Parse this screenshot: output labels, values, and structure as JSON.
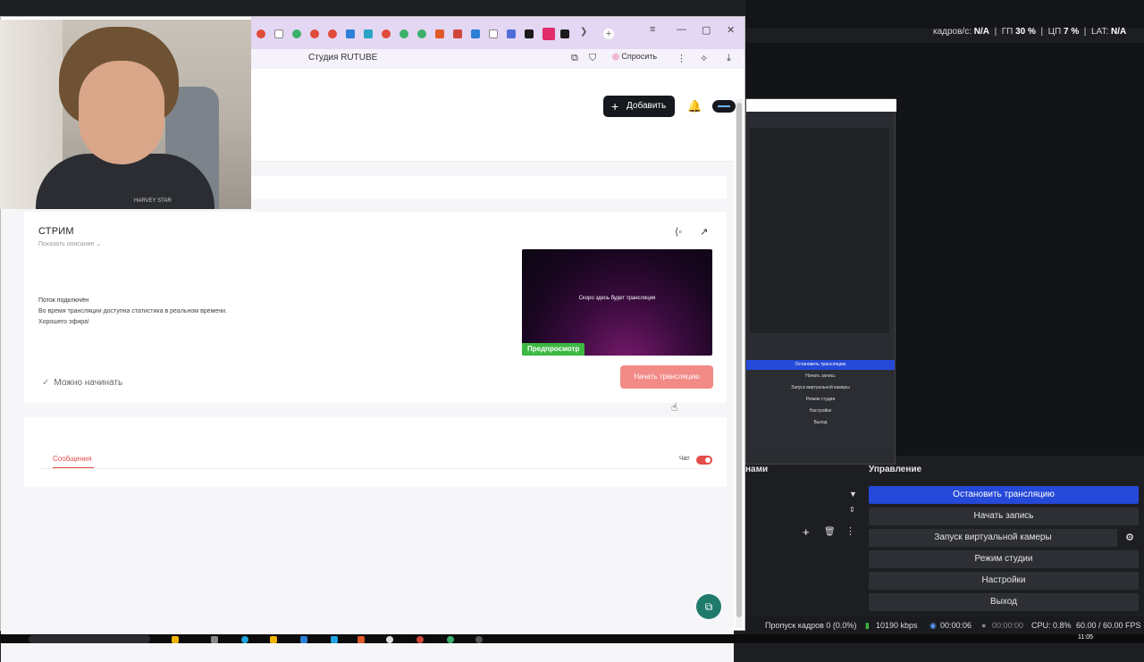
{
  "obs": {
    "top_stats": {
      "frames_label": "кадров/с",
      "frames_value": "N/A",
      "gpu_label": "ГП",
      "gpu_value": "30 %",
      "cpu_label": "ЦП",
      "cpu_value": "7 %",
      "lat_label": "LAT",
      "lat_value": "N/A"
    },
    "scenes_header": "нами",
    "controls_header": "Управление",
    "controls": {
      "stop_stream": "Остановить трансляцию",
      "start_record": "Начать запись",
      "virtual_cam": "Запуск виртуальной камеры",
      "studio_mode": "Режим студии",
      "settings": "Настройки",
      "exit": "Выход"
    },
    "thumb_buttons": [
      "Остановить трансляцию",
      "Начать запись",
      "Запуск виртуальной камеры",
      "Режим студии",
      "Настройки",
      "Выход"
    ],
    "status": {
      "dropped": "Пропуск кадров 0 (0.0%)",
      "bitrate": "10190 kbps",
      "stream_time": "00:00:06",
      "rec_time": "00:00:00",
      "cpu": "CPU: 0.8%",
      "fps": "60.00 / 60.00 FPS"
    }
  },
  "browser": {
    "site_title": "Студия RUTUBE",
    "ask_label": "Спросить",
    "close_symbol": "×"
  },
  "header": {
    "add_label": "Добавить"
  },
  "stream": {
    "title": "СТРИМ",
    "show_description": "Показать описание ⌄",
    "connected_title": "Поток подключён",
    "connected_line1": "Во время трансляции доступна статистика в реальном времени.",
    "connected_line2": "Хорошего эфира!",
    "preview_message": "Скоро здесь будет трансляция",
    "preview_badge": "Предпросмотр",
    "ready_label": "Можно начинать",
    "start_button": "Начать трансляцию"
  },
  "chat": {
    "messages_tab": "Сообщения",
    "chat_label": "Чат",
    "chat_enabled": true
  },
  "webcam": {
    "shirt_text": "HARVEY STAR"
  },
  "taskbar": {
    "clock": "11:05"
  }
}
